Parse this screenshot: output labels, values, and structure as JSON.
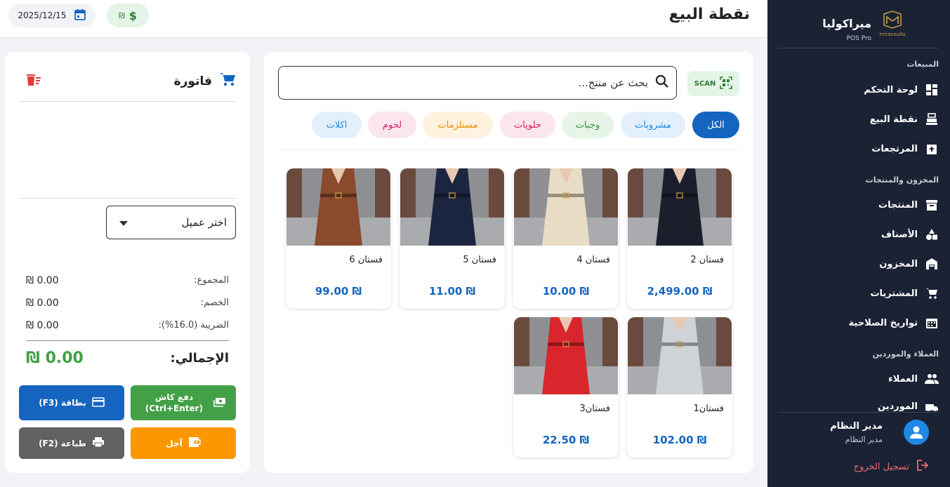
{
  "sidebar": {
    "brand_name": "ميراكوليا",
    "brand_sub": "POS Pro",
    "logo_text": "miracoulla",
    "sections": {
      "sales": "المبيعات",
      "inventory": "المخزون والمنتجات",
      "clients": "العملاء والموردين"
    },
    "items": [
      {
        "label": "لوحة التحكم",
        "icon": "dashboard-icon"
      },
      {
        "label": "نقطة البيع",
        "icon": "pos-icon"
      },
      {
        "label": "المرتجعات",
        "icon": "returns-icon"
      },
      {
        "label": "المنتجات",
        "icon": "archive-icon"
      },
      {
        "label": "الأصناف",
        "icon": "categories-icon"
      },
      {
        "label": "المخزون",
        "icon": "warehouse-icon"
      },
      {
        "label": "المشتريات",
        "icon": "cart-icon"
      },
      {
        "label": "تواريخ الصلاحية",
        "icon": "calendar-icon"
      },
      {
        "label": "العملاء",
        "icon": "people-icon"
      },
      {
        "label": "الموردين",
        "icon": "truck-icon"
      }
    ],
    "user": {
      "name": "مدير النظام",
      "role": "مدير النظام"
    },
    "logout_label": "تسجيل الخروج"
  },
  "header": {
    "title": "نقطة البيع",
    "date": "2025/12/15",
    "currency_symbol": "₪"
  },
  "products_panel": {
    "scan_label": "SCAN",
    "search_placeholder": "بحث عن منتج...",
    "categories": [
      {
        "label": "الكل",
        "active": true
      },
      {
        "label": "مشروبات"
      },
      {
        "label": "وجبات"
      },
      {
        "label": "حلويات"
      },
      {
        "label": "مستلزمات"
      },
      {
        "label": "لحوم"
      },
      {
        "label": "اكلات"
      }
    ],
    "products": [
      {
        "name": "فستان 2",
        "price": "₪ 2,499.00",
        "color": "#1b1f2b"
      },
      {
        "name": "فستان 4",
        "price": "₪ 10.00",
        "color": "#e9dcc4"
      },
      {
        "name": "فستان 5",
        "price": "₪ 11.00",
        "color": "#1c2540"
      },
      {
        "name": "فستان 6",
        "price": "₪ 99.00",
        "color": "#8a4a2c"
      },
      {
        "name": "فستان1",
        "price": "₪ 102.00",
        "color": "#cfd2d6"
      },
      {
        "name": "فستان3",
        "price": "₪ 22.50",
        "color": "#d9262c"
      }
    ]
  },
  "invoice": {
    "title": "فاتورة",
    "customer_placeholder": "اختر عميل",
    "subtotal_label": "المجموع:",
    "subtotal_value": "0.00 ₪",
    "discount_label": "الخصم:",
    "discount_value": "0.00 ₪",
    "tax_label": "الضريبة (16.0%):",
    "tax_value": "0.00 ₪",
    "total_label": "الإجمالي:",
    "total_value": "0.00 ₪",
    "buttons": {
      "cash": "دفع كاش (Ctrl+Enter)",
      "card": "بطاقة (F3)",
      "credit": "آجل",
      "print": "طباعة (F2)"
    },
    "colors": {
      "cash": "#43a047",
      "card": "#1565c0",
      "credit": "#fb9800",
      "print": "#616161"
    }
  }
}
